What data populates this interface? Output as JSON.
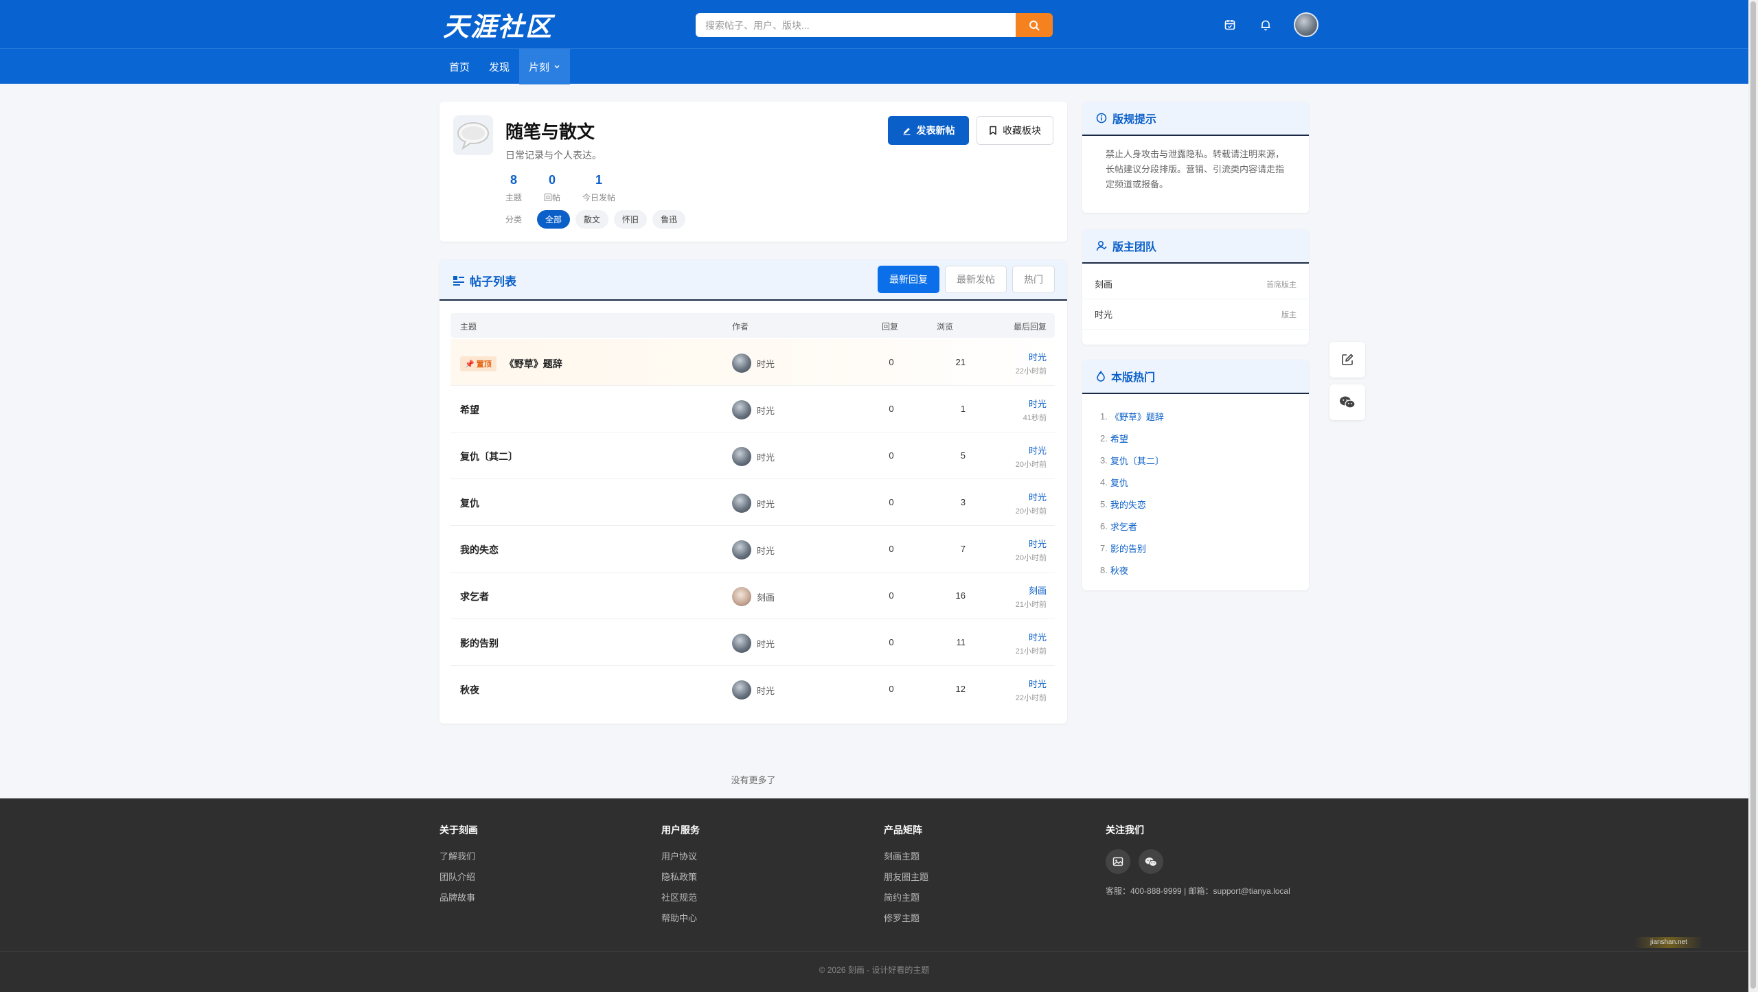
{
  "header": {
    "logo": "天涯社区",
    "search_placeholder": "搜索帖子、用户、版块...",
    "icons": [
      "calendar-icon",
      "bell-icon"
    ]
  },
  "nav": {
    "items": [
      "首页",
      "发现",
      "片刻"
    ]
  },
  "forum": {
    "title": "随笔与散文",
    "description": "日常记录与个人表达。",
    "stats": [
      {
        "num": "8",
        "label": "主题"
      },
      {
        "num": "0",
        "label": "回帖"
      },
      {
        "num": "1",
        "label": "今日发帖"
      }
    ],
    "category_label": "分类",
    "categories": [
      "全部",
      "散文",
      "怀旧",
      "鲁迅"
    ],
    "post_button": "发表新帖",
    "fav_button": "收藏板块"
  },
  "list": {
    "title": "帖子列表",
    "sort_tabs": [
      "最新回复",
      "最新发帖",
      "热门"
    ],
    "columns": [
      "主题",
      "作者",
      "回复",
      "浏览",
      "最后回复"
    ],
    "pin_label": "置顶",
    "rows": [
      {
        "subject": "《野草》题辞",
        "author": "时光",
        "replies": "0",
        "views": "21",
        "last_user": "时光",
        "last_time": "22小时前",
        "pinned": true
      },
      {
        "subject": "希望",
        "author": "时光",
        "replies": "0",
        "views": "1",
        "last_user": "时光",
        "last_time": "41秒前"
      },
      {
        "subject": "复仇〔其二〕",
        "author": "时光",
        "replies": "0",
        "views": "5",
        "last_user": "时光",
        "last_time": "20小时前"
      },
      {
        "subject": "复仇",
        "author": "时光",
        "replies": "0",
        "views": "3",
        "last_user": "时光",
        "last_time": "20小时前"
      },
      {
        "subject": "我的失恋",
        "author": "时光",
        "replies": "0",
        "views": "7",
        "last_user": "时光",
        "last_time": "20小时前"
      },
      {
        "subject": "求乞者",
        "author": "刻画",
        "replies": "0",
        "views": "16",
        "last_user": "刻画",
        "last_time": "21小时前"
      },
      {
        "subject": "影的告别",
        "author": "时光",
        "replies": "0",
        "views": "11",
        "last_user": "时光",
        "last_time": "21小时前"
      },
      {
        "subject": "秋夜",
        "author": "时光",
        "replies": "0",
        "views": "12",
        "last_user": "时光",
        "last_time": "22小时前"
      }
    ],
    "no_more": "没有更多了"
  },
  "sidebar": {
    "rules": {
      "title": "版规提示",
      "text": "禁止人身攻击与泄露隐私。转载请注明来源，长帖建议分段排版。营销、引流类内容请走指定频道或报备。"
    },
    "mods": {
      "title": "版主团队",
      "items": [
        {
          "name": "刻画",
          "role": "首席版主"
        },
        {
          "name": "时光",
          "role": "版主"
        }
      ]
    },
    "hot": {
      "title": "本版热门",
      "items": [
        {
          "num": "1.",
          "title": "《野草》题辞"
        },
        {
          "num": "2.",
          "title": "希望"
        },
        {
          "num": "3.",
          "title": "复仇〔其二〕"
        },
        {
          "num": "4.",
          "title": "复仇"
        },
        {
          "num": "5.",
          "title": "我的失恋"
        },
        {
          "num": "6.",
          "title": "求乞者"
        },
        {
          "num": "7.",
          "title": "影的告别"
        },
        {
          "num": "8.",
          "title": "秋夜"
        }
      ]
    }
  },
  "footer": {
    "cols": [
      {
        "title": "关于刻画",
        "links": [
          "了解我们",
          "团队介绍",
          "品牌故事"
        ]
      },
      {
        "title": "用户服务",
        "links": [
          "用户协议",
          "隐私政策",
          "社区规范",
          "帮助中心"
        ]
      },
      {
        "title": "产品矩阵",
        "links": [
          "刻画主题",
          "朋友圈主题",
          "简约主题",
          "修罗主题"
        ]
      }
    ],
    "follow_title": "关注我们",
    "contact": "客服：400-888-9999 | 邮箱：support@tianya.local",
    "copyright": "© 2026 刻画 - 设计好看的主题",
    "watermark": "jianshan.net"
  },
  "colors": {
    "brand": "#0862d0",
    "accent": "#f5811f",
    "footer_bg": "#2f2f2f"
  }
}
